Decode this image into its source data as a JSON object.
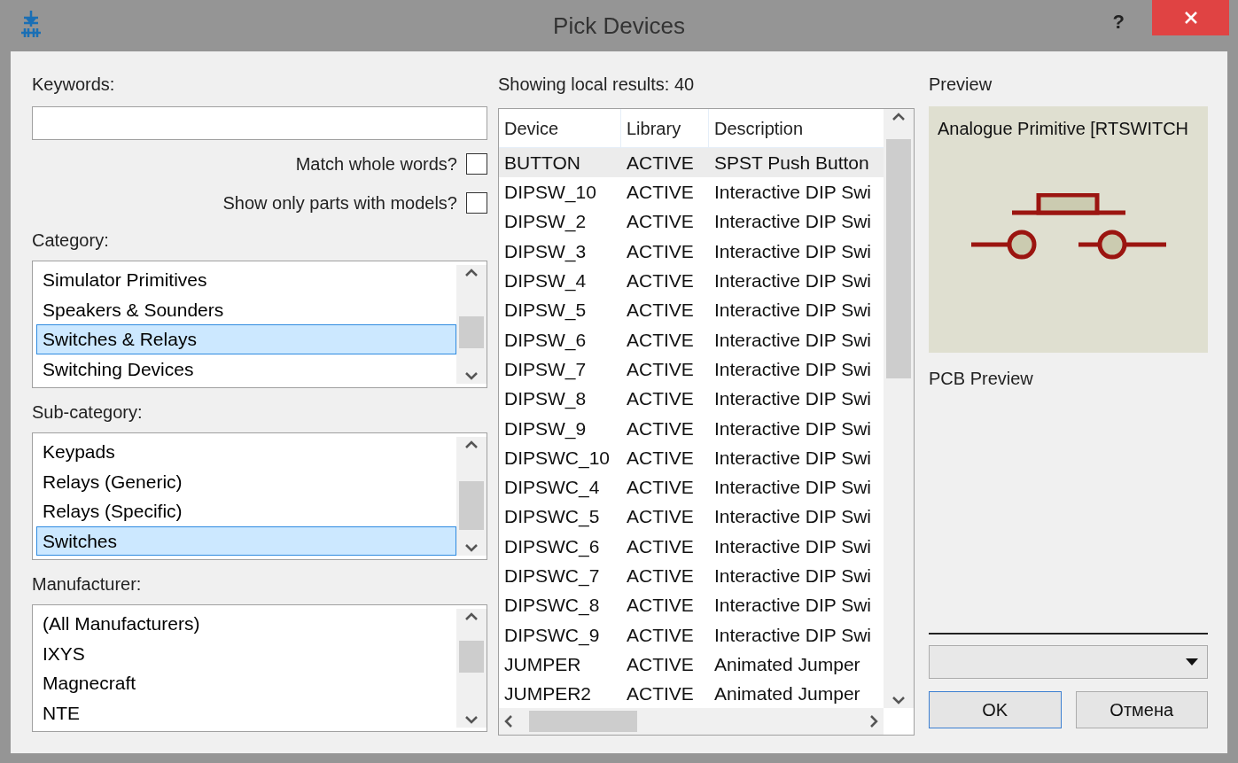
{
  "window": {
    "title": "Pick Devices",
    "help": "?"
  },
  "keywords": {
    "label": "Keywords:"
  },
  "options": [
    {
      "label": "Match whole words?",
      "checked": false
    },
    {
      "label": "Show only parts with models?",
      "checked": false
    }
  ],
  "category": {
    "label": "Category:",
    "items": [
      {
        "label": "Simulator Primitives",
        "selected": false
      },
      {
        "label": "Speakers & Sounders",
        "selected": false
      },
      {
        "label": "Switches & Relays",
        "selected": true
      },
      {
        "label": "Switching Devices",
        "selected": false
      }
    ]
  },
  "sub_category": {
    "label": "Sub-category:",
    "items": [
      {
        "label": "Keypads",
        "selected": false
      },
      {
        "label": "Relays (Generic)",
        "selected": false
      },
      {
        "label": "Relays (Specific)",
        "selected": false
      },
      {
        "label": "Switches",
        "selected": true
      }
    ]
  },
  "manufacturer": {
    "label": "Manufacturer:",
    "items": [
      {
        "label": "(All Manufacturers)",
        "selected": false
      },
      {
        "label": "IXYS",
        "selected": false
      },
      {
        "label": "Magnecraft",
        "selected": false
      },
      {
        "label": "NTE",
        "selected": false
      }
    ]
  },
  "results": {
    "label": "Showing local results: 40",
    "columns": [
      "Device",
      "Library",
      "Description"
    ],
    "rows": [
      {
        "cells": [
          "BUTTON",
          "ACTIVE",
          "SPST Push Button"
        ],
        "selected": true
      },
      {
        "cells": [
          "DIPSW_10",
          "ACTIVE",
          "Interactive DIP Swi"
        ],
        "selected": false
      },
      {
        "cells": [
          "DIPSW_2",
          "ACTIVE",
          "Interactive DIP Swi"
        ],
        "selected": false
      },
      {
        "cells": [
          "DIPSW_3",
          "ACTIVE",
          "Interactive DIP Swi"
        ],
        "selected": false
      },
      {
        "cells": [
          "DIPSW_4",
          "ACTIVE",
          "Interactive DIP Swi"
        ],
        "selected": false
      },
      {
        "cells": [
          "DIPSW_5",
          "ACTIVE",
          "Interactive DIP Swi"
        ],
        "selected": false
      },
      {
        "cells": [
          "DIPSW_6",
          "ACTIVE",
          "Interactive DIP Swi"
        ],
        "selected": false
      },
      {
        "cells": [
          "DIPSW_7",
          "ACTIVE",
          "Interactive DIP Swi"
        ],
        "selected": false
      },
      {
        "cells": [
          "DIPSW_8",
          "ACTIVE",
          "Interactive DIP Swi"
        ],
        "selected": false
      },
      {
        "cells": [
          "DIPSW_9",
          "ACTIVE",
          "Interactive DIP Swi"
        ],
        "selected": false
      },
      {
        "cells": [
          "DIPSWC_10",
          "ACTIVE",
          "Interactive DIP Swi"
        ],
        "selected": false
      },
      {
        "cells": [
          "DIPSWC_4",
          "ACTIVE",
          "Interactive DIP Swi"
        ],
        "selected": false
      },
      {
        "cells": [
          "DIPSWC_5",
          "ACTIVE",
          "Interactive DIP Swi"
        ],
        "selected": false
      },
      {
        "cells": [
          "DIPSWC_6",
          "ACTIVE",
          "Interactive DIP Swi"
        ],
        "selected": false
      },
      {
        "cells": [
          "DIPSWC_7",
          "ACTIVE",
          "Interactive DIP Swi"
        ],
        "selected": false
      },
      {
        "cells": [
          "DIPSWC_8",
          "ACTIVE",
          "Interactive DIP Swi"
        ],
        "selected": false
      },
      {
        "cells": [
          "DIPSWC_9",
          "ACTIVE",
          "Interactive DIP Swi"
        ],
        "selected": false
      },
      {
        "cells": [
          "JUMPER",
          "ACTIVE",
          "Animated Jumper"
        ],
        "selected": false
      },
      {
        "cells": [
          "JUMPER2",
          "ACTIVE",
          "Animated Jumper"
        ],
        "selected": false
      }
    ]
  },
  "preview": {
    "label": "Preview",
    "caption": "Analogue Primitive [RTSWITCH"
  },
  "pcb_preview": {
    "label": "PCB Preview"
  },
  "buttons": [
    {
      "label": "OK",
      "default": true
    },
    {
      "label": "Отмена",
      "default": false
    }
  ]
}
